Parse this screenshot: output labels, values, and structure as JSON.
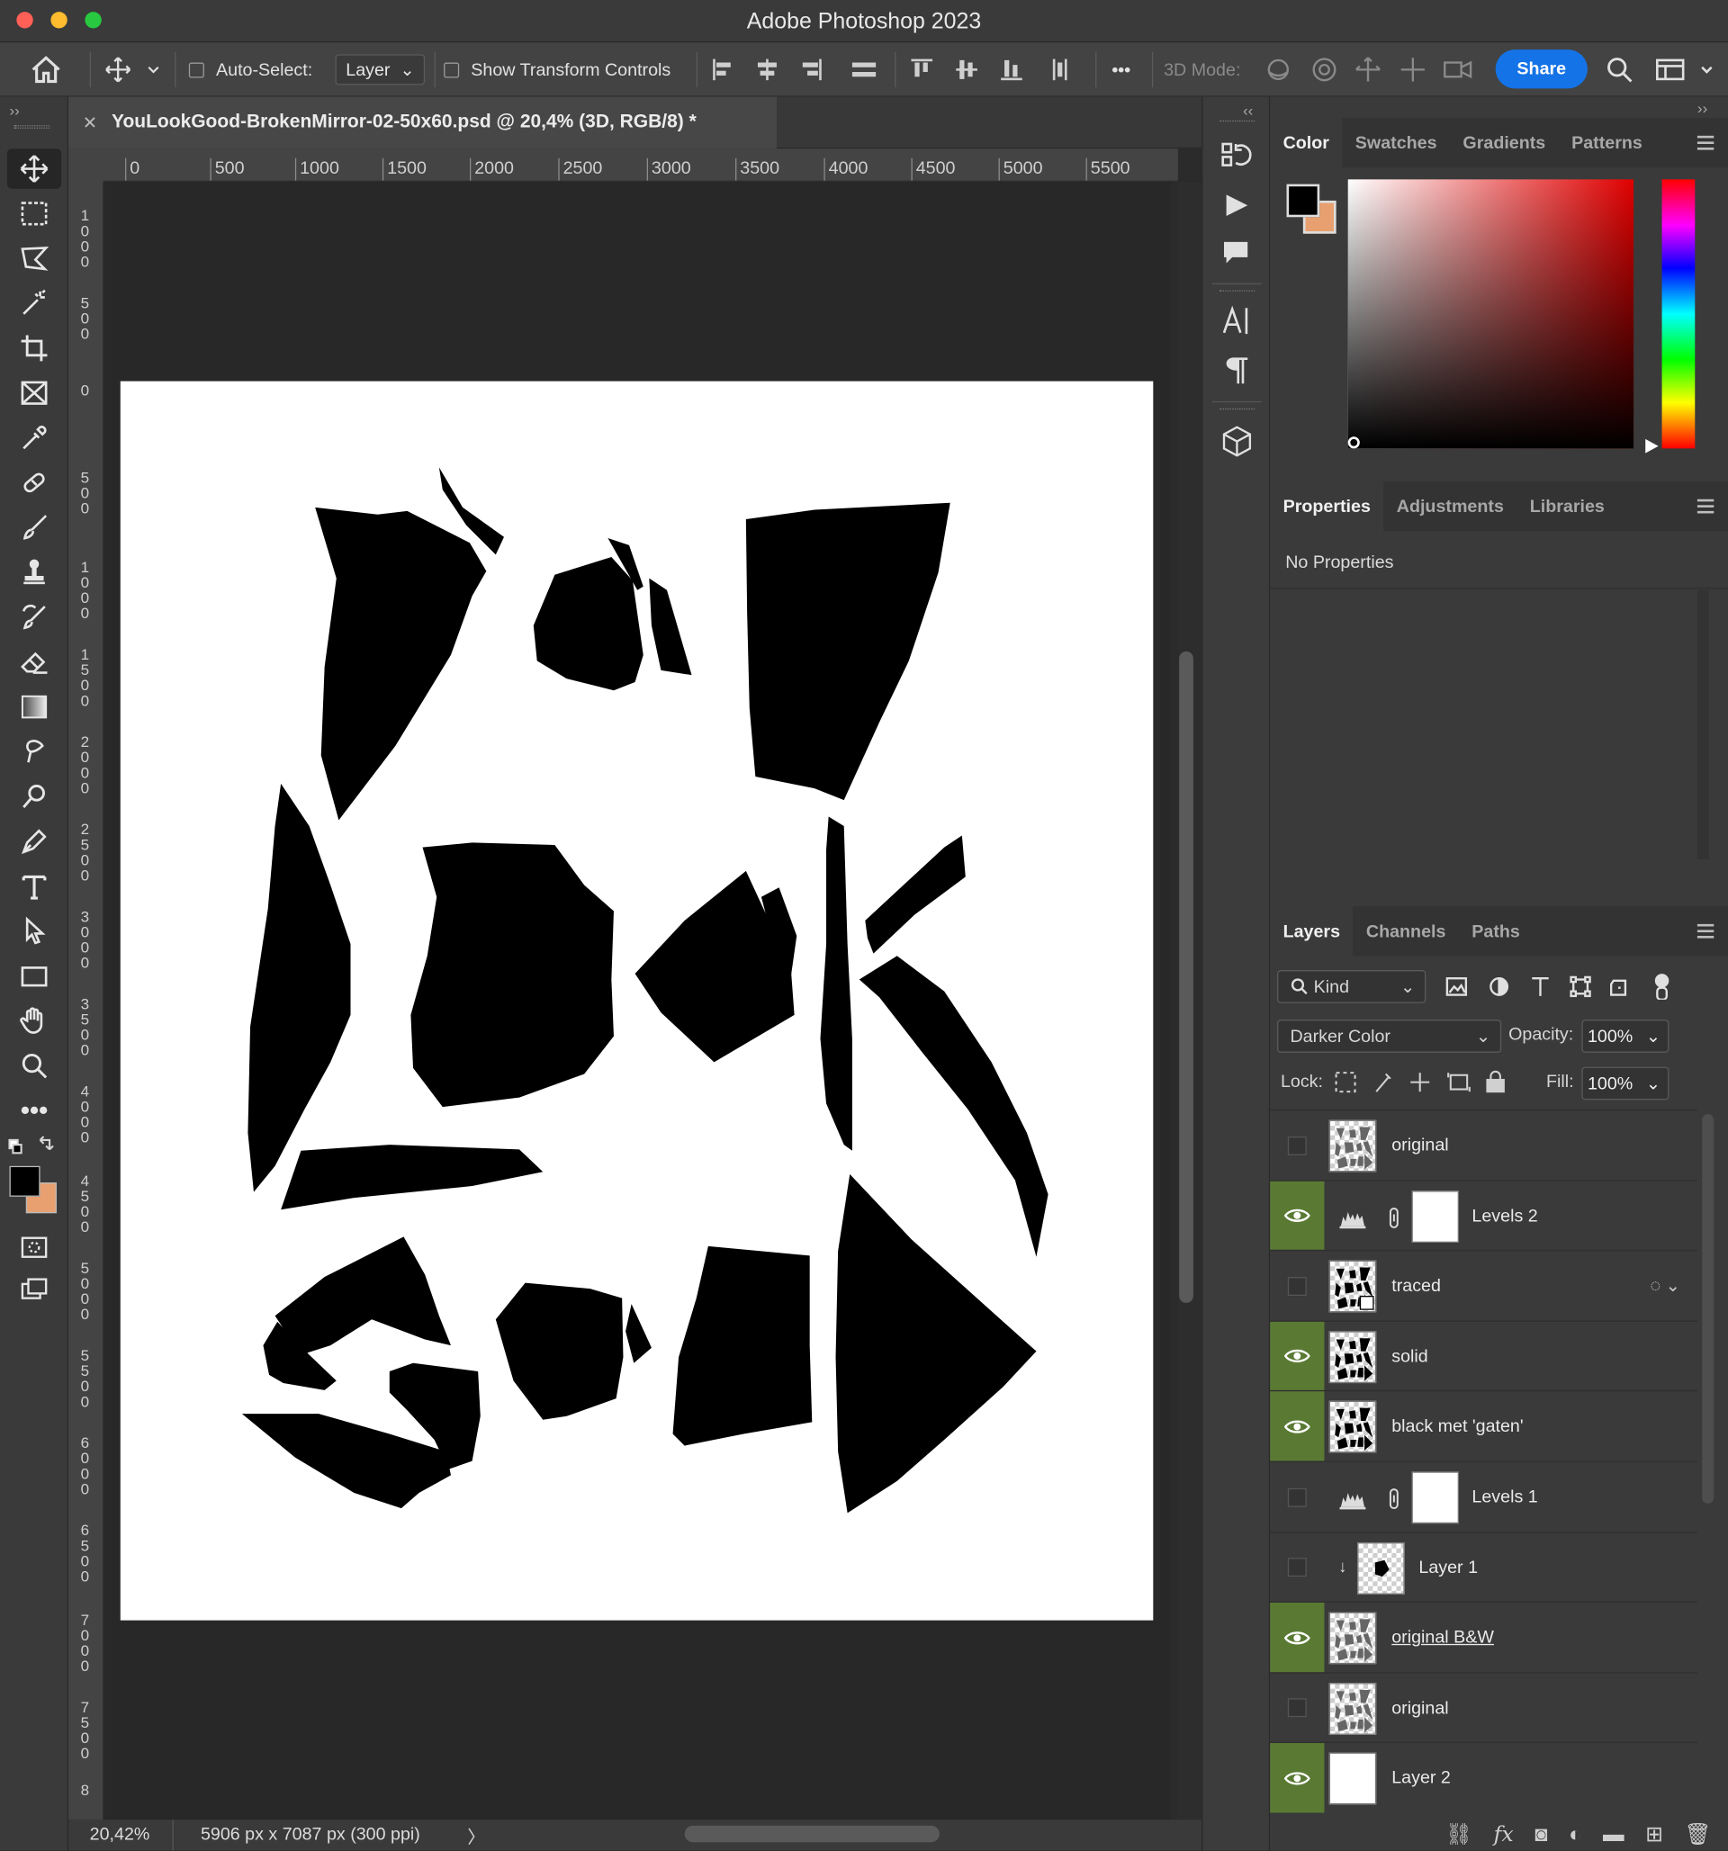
{
  "app_title": "Adobe Photoshop 2023",
  "options_bar": {
    "auto_select_label": "Auto-Select:",
    "auto_select_value": "Layer",
    "show_transform_label": "Show Transform Controls",
    "more_label": "•••",
    "mode_3d_label": "3D Mode:",
    "share_label": "Share"
  },
  "document": {
    "tab_title": "YouLookGood-BrokenMirror-02-50x60.psd @ 20,4% (3D, RGB/8) *",
    "close_glyph": "✕"
  },
  "ruler": {
    "h_ticks": [
      "0",
      "500",
      "1000",
      "1500",
      "2000",
      "2500",
      "3000",
      "3500",
      "4000",
      "4500",
      "5000",
      "5500"
    ],
    "v_ticks": [
      "1000",
      "500",
      "0",
      "500",
      "1000",
      "1500",
      "2000",
      "2500",
      "3000",
      "3500",
      "4000",
      "4500",
      "5000",
      "5500",
      "6000",
      "6500",
      "7000",
      "7500",
      "8"
    ]
  },
  "status": {
    "zoom": "20,42%",
    "doc_size": "5906 px x 7087 px (300 ppi)",
    "arrow": "〉"
  },
  "color_panel": {
    "tabs": [
      "Color",
      "Swatches",
      "Gradients",
      "Patterns"
    ],
    "foreground": "#000000",
    "background": "#e8a070"
  },
  "properties_panel": {
    "tabs": [
      "Properties",
      "Adjustments",
      "Libraries"
    ],
    "message": "No Properties"
  },
  "layers_panel": {
    "tabs": [
      "Layers",
      "Channels",
      "Paths"
    ],
    "kind_label": "Kind",
    "blend_mode": "Darker Color",
    "opacity_label": "Opacity:",
    "opacity_value": "100%",
    "lock_label": "Lock:",
    "fill_label": "Fill:",
    "fill_value": "100%",
    "layers": [
      {
        "name": "original",
        "visible": false,
        "type": "image"
      },
      {
        "name": "Levels 2",
        "visible": true,
        "type": "adjustment"
      },
      {
        "name": "traced",
        "visible": false,
        "type": "smart"
      },
      {
        "name": "solid",
        "visible": true,
        "type": "image"
      },
      {
        "name": "black met 'gaten'",
        "visible": true,
        "type": "image"
      },
      {
        "name": "Levels 1",
        "visible": false,
        "type": "adjustment"
      },
      {
        "name": "Layer 1",
        "visible": false,
        "type": "clipped"
      },
      {
        "name": "original B&W",
        "visible": true,
        "type": "image"
      },
      {
        "name": "original",
        "visible": false,
        "type": "image"
      },
      {
        "name": "Layer 2",
        "visible": true,
        "type": "white"
      }
    ]
  },
  "colors": {
    "accent": "#1473e6",
    "visible_highlight": "#5a7a33"
  }
}
